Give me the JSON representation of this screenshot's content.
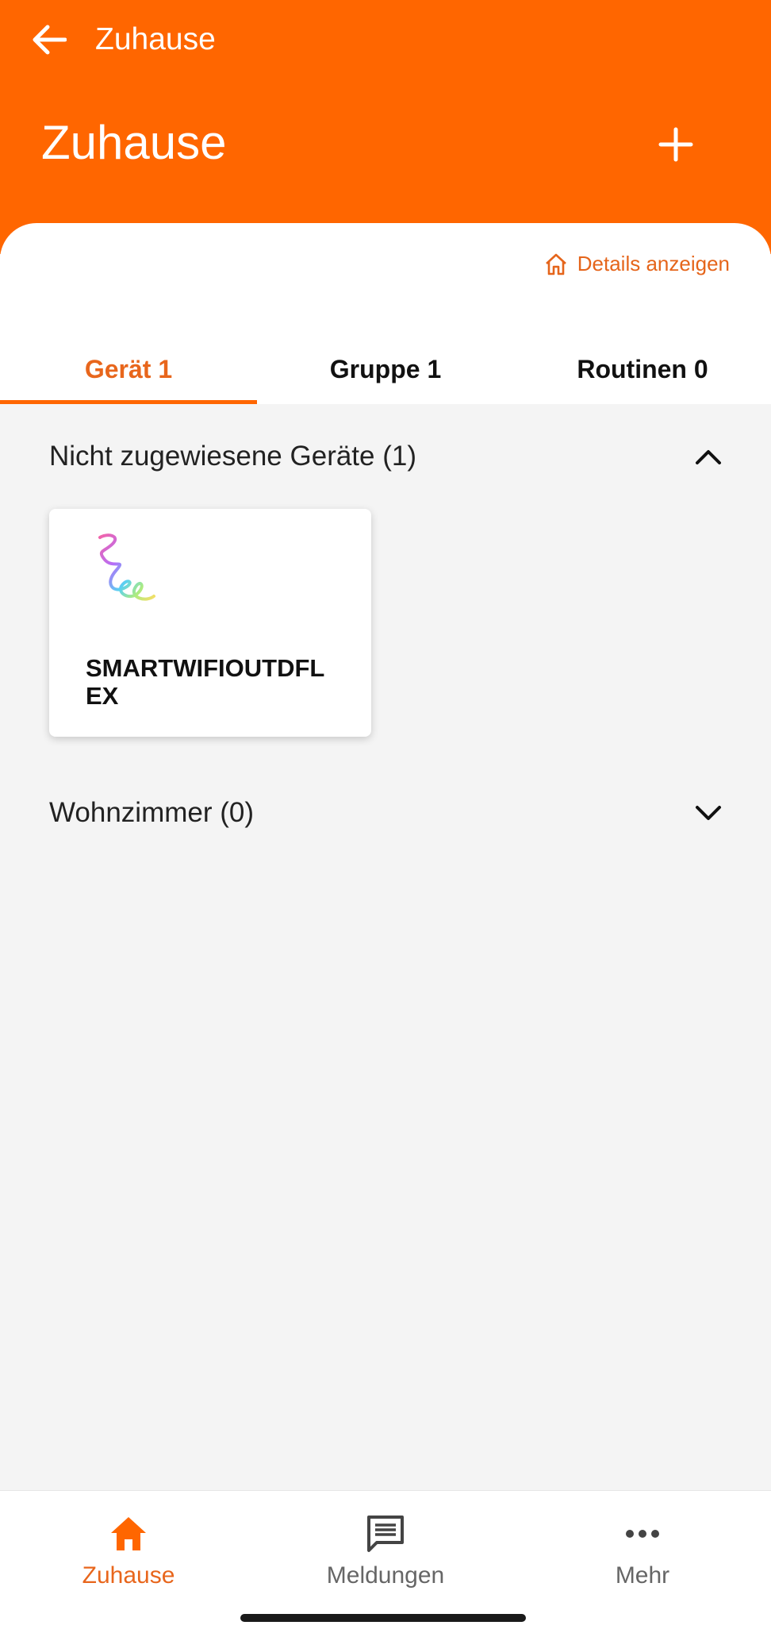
{
  "header": {
    "back_icon": "arrow-left-icon",
    "nav_title": "Zuhause",
    "page_title": "Zuhause",
    "add_icon": "plus-icon",
    "background_color": "#ff6600"
  },
  "details_link": {
    "icon": "home-outline-icon",
    "label": "Details anzeigen"
  },
  "tabs": [
    {
      "label": "Gerät 1",
      "active": true
    },
    {
      "label": "Gruppe 1",
      "active": false
    },
    {
      "label": "Routinen 0",
      "active": false
    }
  ],
  "sections": [
    {
      "label": "Nicht zugewiesene Geräte (1)",
      "expanded": true,
      "chevron": "chevron-up-icon"
    },
    {
      "label": "Wohnzimmer (0)",
      "expanded": false,
      "chevron": "chevron-down-icon"
    }
  ],
  "device_card": {
    "name": "SMARTWIFIOUTDFLEX",
    "image": "led-strip-image"
  },
  "bottom_nav": [
    {
      "label": "Zuhause",
      "icon": "home-icon",
      "active": true
    },
    {
      "label": "Meldungen",
      "icon": "message-icon",
      "active": false
    },
    {
      "label": "Mehr",
      "icon": "more-icon",
      "active": false
    }
  ],
  "colors": {
    "accent": "#ff6600",
    "accent_text": "#e8661c",
    "background": "#f4f4f4"
  }
}
